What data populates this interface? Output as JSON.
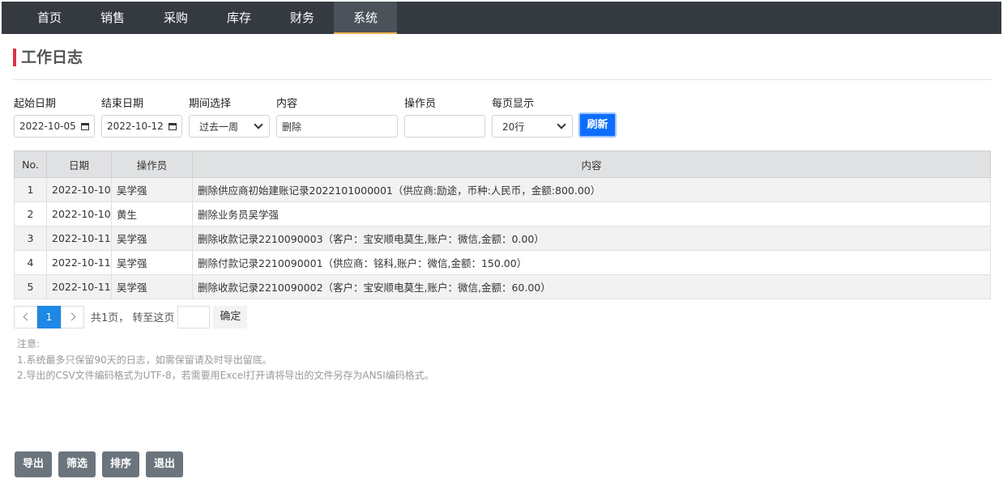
{
  "nav": {
    "items": [
      "首页",
      "销售",
      "采购",
      "库存",
      "财务",
      "系统"
    ],
    "active": "系统"
  },
  "page": {
    "title": "工作日志"
  },
  "filters": {
    "start_date": {
      "label": "起始日期",
      "value": "2022-10-05"
    },
    "end_date": {
      "label": "结束日期",
      "value": "2022-10-12"
    },
    "period": {
      "label": "期间选择",
      "value": "过去一周"
    },
    "content": {
      "label": "内容",
      "value": "删除"
    },
    "operator": {
      "label": "操作员",
      "value": ""
    },
    "page_size": {
      "label": "每页显示",
      "value": "20行"
    },
    "refresh_label": "刷新"
  },
  "table": {
    "columns": [
      "No.",
      "日期",
      "操作员",
      "内容"
    ],
    "rows": [
      {
        "no": "1",
        "date": "2022-10-10",
        "operator": "吴学强",
        "content": "删除供应商初始建账记录2022101000001（供应商:励途，币种:人民币，金额:800.00）"
      },
      {
        "no": "2",
        "date": "2022-10-10",
        "operator": "黄生",
        "content": "删除业务员吴学强"
      },
      {
        "no": "3",
        "date": "2022-10-11",
        "operator": "吴学强",
        "content": "删除收款记录2210090003（客户：宝安顺电莫生,账户：微信,金额：0.00）"
      },
      {
        "no": "4",
        "date": "2022-10-11",
        "operator": "吴学强",
        "content": "删除付款记录2210090001（供应商：铭科,账户：微信,金额：150.00）"
      },
      {
        "no": "5",
        "date": "2022-10-11",
        "operator": "吴学强",
        "content": "删除收款记录2210090002（客户：宝安顺电莫生,账户：微信,金额：60.00）"
      }
    ]
  },
  "pager": {
    "current_page": "1",
    "summary": "共1页，  转至这页",
    "goto_value": "",
    "confirm_label": "确定"
  },
  "notes": {
    "title": "注意:",
    "lines": [
      "1.系统最多只保留90天的日志，如需保留请及时导出留底。",
      "2.导出的CSV文件编码格式为UTF-8，若需要用Excel打开请将导出的文件另存为ANSI编码格式。"
    ]
  },
  "actions": {
    "export": "导出",
    "filter": "筛选",
    "sort": "排序",
    "exit": "退出"
  },
  "colors": {
    "nav_bg": "#343a40",
    "nav_active_underline": "#f0ad4e",
    "title_accent": "#dc3545",
    "primary": "#0d6efd",
    "pager_active": "#1e88e5",
    "action_btn": "#6c757d"
  }
}
